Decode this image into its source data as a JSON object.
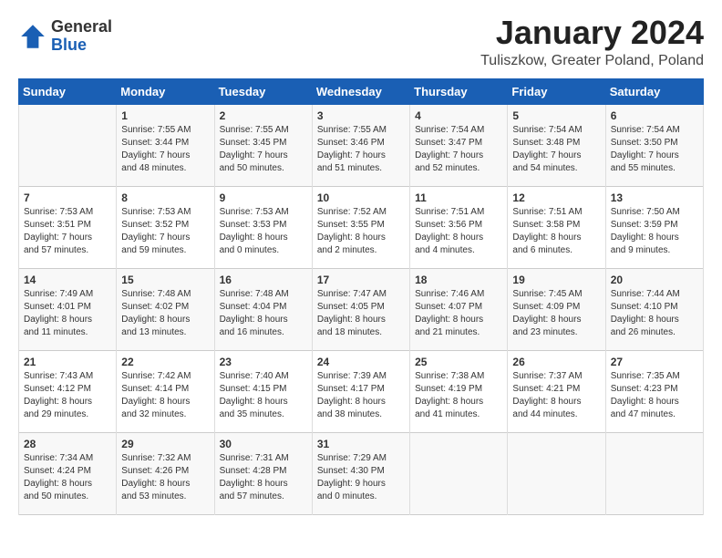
{
  "header": {
    "logo_general": "General",
    "logo_blue": "Blue",
    "month": "January 2024",
    "location": "Tuliszkow, Greater Poland, Poland"
  },
  "days_of_week": [
    "Sunday",
    "Monday",
    "Tuesday",
    "Wednesday",
    "Thursday",
    "Friday",
    "Saturday"
  ],
  "weeks": [
    [
      {
        "day": "",
        "content": ""
      },
      {
        "day": "1",
        "content": "Sunrise: 7:55 AM\nSunset: 3:44 PM\nDaylight: 7 hours\nand 48 minutes."
      },
      {
        "day": "2",
        "content": "Sunrise: 7:55 AM\nSunset: 3:45 PM\nDaylight: 7 hours\nand 50 minutes."
      },
      {
        "day": "3",
        "content": "Sunrise: 7:55 AM\nSunset: 3:46 PM\nDaylight: 7 hours\nand 51 minutes."
      },
      {
        "day": "4",
        "content": "Sunrise: 7:54 AM\nSunset: 3:47 PM\nDaylight: 7 hours\nand 52 minutes."
      },
      {
        "day": "5",
        "content": "Sunrise: 7:54 AM\nSunset: 3:48 PM\nDaylight: 7 hours\nand 54 minutes."
      },
      {
        "day": "6",
        "content": "Sunrise: 7:54 AM\nSunset: 3:50 PM\nDaylight: 7 hours\nand 55 minutes."
      }
    ],
    [
      {
        "day": "7",
        "content": "Sunrise: 7:53 AM\nSunset: 3:51 PM\nDaylight: 7 hours\nand 57 minutes."
      },
      {
        "day": "8",
        "content": "Sunrise: 7:53 AM\nSunset: 3:52 PM\nDaylight: 7 hours\nand 59 minutes."
      },
      {
        "day": "9",
        "content": "Sunrise: 7:53 AM\nSunset: 3:53 PM\nDaylight: 8 hours\nand 0 minutes."
      },
      {
        "day": "10",
        "content": "Sunrise: 7:52 AM\nSunset: 3:55 PM\nDaylight: 8 hours\nand 2 minutes."
      },
      {
        "day": "11",
        "content": "Sunrise: 7:51 AM\nSunset: 3:56 PM\nDaylight: 8 hours\nand 4 minutes."
      },
      {
        "day": "12",
        "content": "Sunrise: 7:51 AM\nSunset: 3:58 PM\nDaylight: 8 hours\nand 6 minutes."
      },
      {
        "day": "13",
        "content": "Sunrise: 7:50 AM\nSunset: 3:59 PM\nDaylight: 8 hours\nand 9 minutes."
      }
    ],
    [
      {
        "day": "14",
        "content": "Sunrise: 7:49 AM\nSunset: 4:01 PM\nDaylight: 8 hours\nand 11 minutes."
      },
      {
        "day": "15",
        "content": "Sunrise: 7:48 AM\nSunset: 4:02 PM\nDaylight: 8 hours\nand 13 minutes."
      },
      {
        "day": "16",
        "content": "Sunrise: 7:48 AM\nSunset: 4:04 PM\nDaylight: 8 hours\nand 16 minutes."
      },
      {
        "day": "17",
        "content": "Sunrise: 7:47 AM\nSunset: 4:05 PM\nDaylight: 8 hours\nand 18 minutes."
      },
      {
        "day": "18",
        "content": "Sunrise: 7:46 AM\nSunset: 4:07 PM\nDaylight: 8 hours\nand 21 minutes."
      },
      {
        "day": "19",
        "content": "Sunrise: 7:45 AM\nSunset: 4:09 PM\nDaylight: 8 hours\nand 23 minutes."
      },
      {
        "day": "20",
        "content": "Sunrise: 7:44 AM\nSunset: 4:10 PM\nDaylight: 8 hours\nand 26 minutes."
      }
    ],
    [
      {
        "day": "21",
        "content": "Sunrise: 7:43 AM\nSunset: 4:12 PM\nDaylight: 8 hours\nand 29 minutes."
      },
      {
        "day": "22",
        "content": "Sunrise: 7:42 AM\nSunset: 4:14 PM\nDaylight: 8 hours\nand 32 minutes."
      },
      {
        "day": "23",
        "content": "Sunrise: 7:40 AM\nSunset: 4:15 PM\nDaylight: 8 hours\nand 35 minutes."
      },
      {
        "day": "24",
        "content": "Sunrise: 7:39 AM\nSunset: 4:17 PM\nDaylight: 8 hours\nand 38 minutes."
      },
      {
        "day": "25",
        "content": "Sunrise: 7:38 AM\nSunset: 4:19 PM\nDaylight: 8 hours\nand 41 minutes."
      },
      {
        "day": "26",
        "content": "Sunrise: 7:37 AM\nSunset: 4:21 PM\nDaylight: 8 hours\nand 44 minutes."
      },
      {
        "day": "27",
        "content": "Sunrise: 7:35 AM\nSunset: 4:23 PM\nDaylight: 8 hours\nand 47 minutes."
      }
    ],
    [
      {
        "day": "28",
        "content": "Sunrise: 7:34 AM\nSunset: 4:24 PM\nDaylight: 8 hours\nand 50 minutes."
      },
      {
        "day": "29",
        "content": "Sunrise: 7:32 AM\nSunset: 4:26 PM\nDaylight: 8 hours\nand 53 minutes."
      },
      {
        "day": "30",
        "content": "Sunrise: 7:31 AM\nSunset: 4:28 PM\nDaylight: 8 hours\nand 57 minutes."
      },
      {
        "day": "31",
        "content": "Sunrise: 7:29 AM\nSunset: 4:30 PM\nDaylight: 9 hours\nand 0 minutes."
      },
      {
        "day": "",
        "content": ""
      },
      {
        "day": "",
        "content": ""
      },
      {
        "day": "",
        "content": ""
      }
    ]
  ]
}
